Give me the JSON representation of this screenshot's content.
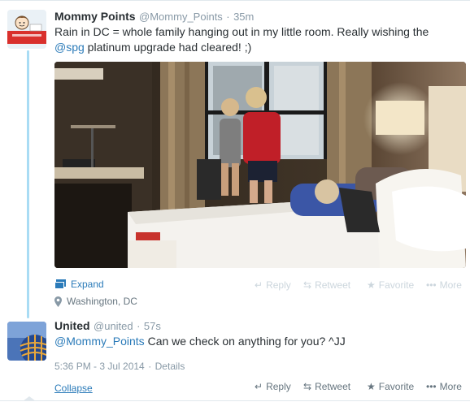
{
  "tweet1": {
    "name": "Mommy Points",
    "handle": "@Mommy_Points",
    "separator": "·",
    "time": "35m",
    "text_part1": "Rain in DC = whole family hanging out in my little room. Really wishing the",
    "mention": "@spg",
    "text_part2": " platinum upgrade had cleared! ;)",
    "expand_label": "Expand",
    "location": "Washington, DC",
    "actions": [
      "Reply",
      "Retweet",
      "Favorite",
      "More"
    ]
  },
  "tweet2": {
    "name": "United",
    "handle": "@united",
    "separator": "·",
    "time": "57s",
    "mention": "@Mommy_Points",
    "text": " Can we check on anything for you? ^JJ",
    "timestamp": "5:36 PM - 3 Jul 2014",
    "details_sep": "·",
    "details": "Details",
    "collapse_label": "Collapse",
    "actions": [
      "Reply",
      "Retweet",
      "Favorite",
      "More"
    ]
  },
  "colors": {
    "link": "#2b7bb9",
    "thread": "#a9dcf4",
    "muted": "#8899a6"
  },
  "icons": [
    "expand-photo-icon",
    "location-pin-icon",
    "reply-icon",
    "retweet-icon",
    "favorite-icon",
    "more-icon"
  ]
}
